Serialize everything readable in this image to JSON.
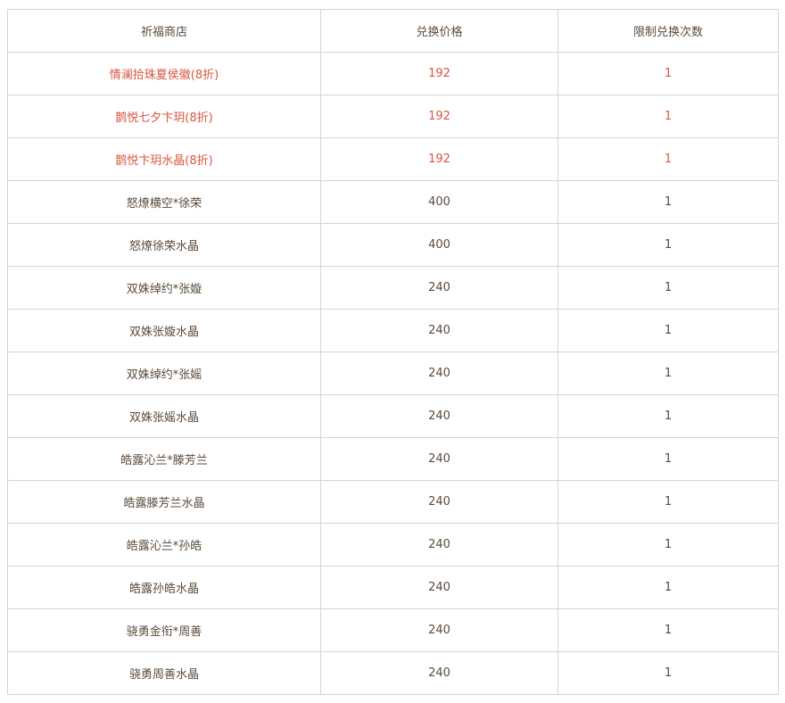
{
  "table": {
    "headers": [
      "祈福商店",
      "兑换价格",
      "限制兑换次数"
    ],
    "highlight_color": "#d9553f",
    "rows": [
      {
        "item": "情澜拾珠夏侯徽(8折)",
        "price": "192",
        "limit": "1",
        "highlight": true
      },
      {
        "item": "鹊悦七夕卞玥(8折)",
        "price": "192",
        "limit": "1",
        "highlight": true
      },
      {
        "item": "鹊悦卞玥水晶(8折)",
        "price": "192",
        "limit": "1",
        "highlight": true
      },
      {
        "item": "怒燎横空*徐荣",
        "price": "400",
        "limit": "1",
        "highlight": false
      },
      {
        "item": "怒燎徐荣水晶",
        "price": "400",
        "limit": "1",
        "highlight": false
      },
      {
        "item": "双姝绰约*张嫙",
        "price": "240",
        "limit": "1",
        "highlight": false
      },
      {
        "item": "双姝张嫙水晶",
        "price": "240",
        "limit": "1",
        "highlight": false
      },
      {
        "item": "双姝绰约*张媱",
        "price": "240",
        "limit": "1",
        "highlight": false
      },
      {
        "item": "双姝张媱水晶",
        "price": "240",
        "limit": "1",
        "highlight": false
      },
      {
        "item": "皓露沁兰*滕芳兰",
        "price": "240",
        "limit": "1",
        "highlight": false
      },
      {
        "item": "皓露滕芳兰水晶",
        "price": "240",
        "limit": "1",
        "highlight": false
      },
      {
        "item": "皓露沁兰*孙皓",
        "price": "240",
        "limit": "1",
        "highlight": false
      },
      {
        "item": "皓露孙皓水晶",
        "price": "240",
        "limit": "1",
        "highlight": false
      },
      {
        "item": "骁勇金衔*周善",
        "price": "240",
        "limit": "1",
        "highlight": false
      },
      {
        "item": "骁勇周善水晶",
        "price": "240",
        "limit": "1",
        "highlight": false
      }
    ]
  }
}
